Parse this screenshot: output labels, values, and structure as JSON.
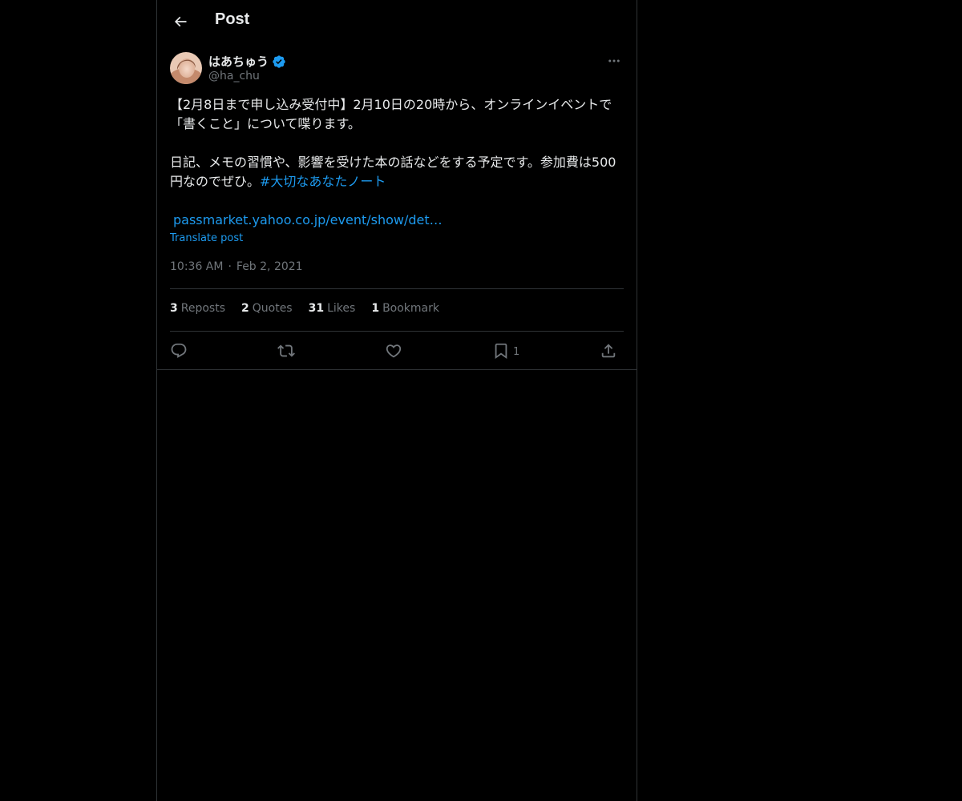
{
  "header": {
    "title": "Post",
    "back_icon": "arrow-left-icon"
  },
  "author": {
    "display_name": "はあちゅう",
    "handle": "@ha_chu",
    "verified": true,
    "verified_color": "#1d9bf0"
  },
  "tweet": {
    "text_main": "【2月8日まで申し込み受付中】2月10日の20時から、オンラインイベントで「書くこと」について喋ります。\n\n日記、メモの習慣や、影響を受けた本の話などをする予定です。参加費は500円なのでぜひ。",
    "hashtag": "#大切なあなたノート",
    "link": "passmarket.yahoo.co.jp/event/show/det…",
    "translate_label": "Translate post",
    "time": "10:36 AM",
    "date": "Feb 2, 2021"
  },
  "stats": {
    "reposts_count": "3",
    "reposts_label": "Reposts",
    "quotes_count": "2",
    "quotes_label": "Quotes",
    "likes_count": "31",
    "likes_label": "Likes",
    "bookmarks_count": "1",
    "bookmarks_label": "Bookmark"
  },
  "actions": {
    "reply_icon": "reply-icon",
    "repost_icon": "repost-icon",
    "like_icon": "heart-icon",
    "bookmark_icon": "bookmark-icon",
    "bookmark_count": "1",
    "share_icon": "share-icon"
  },
  "colors": {
    "background": "#000000",
    "text": "#e7e9ea",
    "secondary": "#71767b",
    "accent": "#1d9bf0",
    "border": "#2f3336"
  }
}
